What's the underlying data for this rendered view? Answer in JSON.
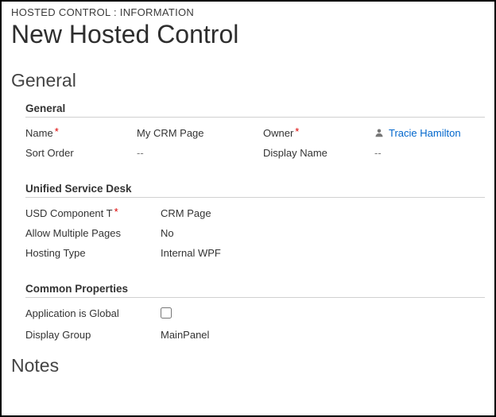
{
  "breadcrumb": "HOSTED CONTROL : INFORMATION",
  "title": "New Hosted Control",
  "tabs": {
    "general": "General",
    "notes": "Notes"
  },
  "sections": {
    "general": {
      "header": "General",
      "fields": {
        "name": {
          "label": "Name",
          "value": "My CRM Page"
        },
        "owner": {
          "label": "Owner",
          "value": "Tracie Hamilton"
        },
        "sortOrder": {
          "label": "Sort Order",
          "value": "--"
        },
        "displayName": {
          "label": "Display Name",
          "value": "--"
        }
      }
    },
    "usd": {
      "header": "Unified Service Desk",
      "fields": {
        "componentType": {
          "label": "USD Component T",
          "value": "CRM Page"
        },
        "allowMulti": {
          "label": "Allow Multiple Pages",
          "value": "No"
        },
        "hostingType": {
          "label": "Hosting Type",
          "value": "Internal WPF"
        }
      }
    },
    "common": {
      "header": "Common Properties",
      "fields": {
        "appGlobal": {
          "label": "Application is Global",
          "checked": false
        },
        "displayGroup": {
          "label": "Display Group",
          "value": "MainPanel"
        }
      }
    }
  }
}
